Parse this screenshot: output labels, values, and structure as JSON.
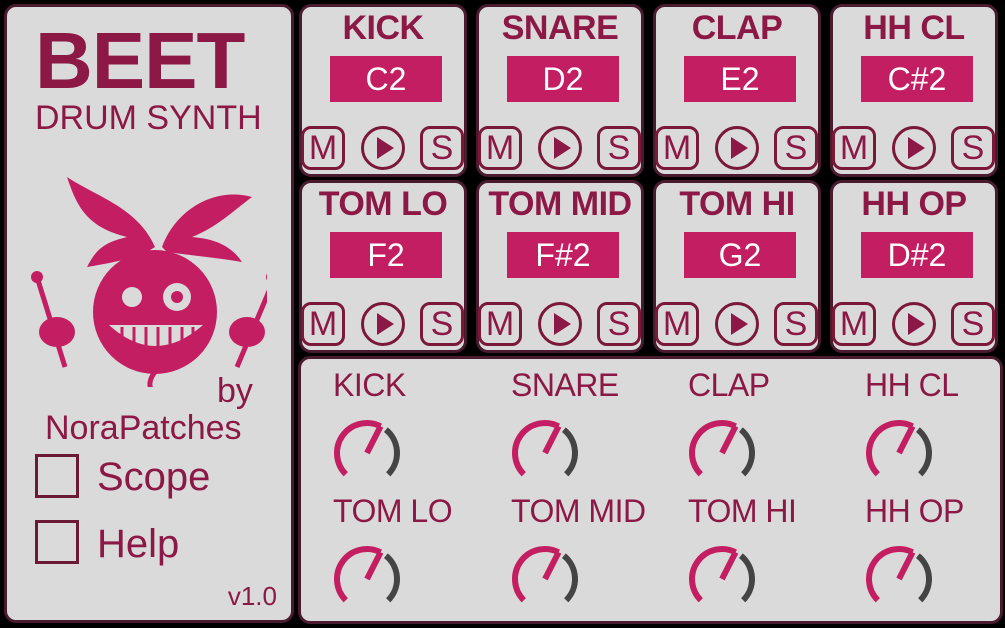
{
  "app": {
    "title": "BEET",
    "subtitle": "DRUM SYNTH",
    "by": "by",
    "author": "NoraPatches",
    "version": "v1.0"
  },
  "options": {
    "scope_label": "Scope",
    "help_label": "Help"
  },
  "pads": [
    {
      "name": "KICK",
      "note": "C2",
      "mute": "M",
      "solo": "S"
    },
    {
      "name": "SNARE",
      "note": "D2",
      "mute": "M",
      "solo": "S"
    },
    {
      "name": "CLAP",
      "note": "E2",
      "mute": "M",
      "solo": "S"
    },
    {
      "name": "HH CL",
      "note": "C#2",
      "mute": "M",
      "solo": "S"
    },
    {
      "name": "TOM LO",
      "note": "F2",
      "mute": "M",
      "solo": "S"
    },
    {
      "name": "TOM MID",
      "note": "F#2",
      "mute": "M",
      "solo": "S"
    },
    {
      "name": "TOM HI",
      "note": "G2",
      "mute": "M",
      "solo": "S"
    },
    {
      "name": "HH OP",
      "note": "D#2",
      "mute": "M",
      "solo": "S"
    }
  ],
  "mixer": [
    {
      "name": "KICK",
      "level": 0.6
    },
    {
      "name": "SNARE",
      "level": 0.6
    },
    {
      "name": "CLAP",
      "level": 0.6
    },
    {
      "name": "HH CL",
      "level": 0.6
    },
    {
      "name": "TOM LO",
      "level": 0.6
    },
    {
      "name": "TOM MID",
      "level": 0.6
    },
    {
      "name": "TOM HI",
      "level": 0.6
    },
    {
      "name": "HH OP",
      "level": 0.6
    }
  ],
  "colors": {
    "accent": "#c41e63",
    "text": "#8c1845",
    "panel": "#dadada",
    "border": "#4a1a2e"
  }
}
